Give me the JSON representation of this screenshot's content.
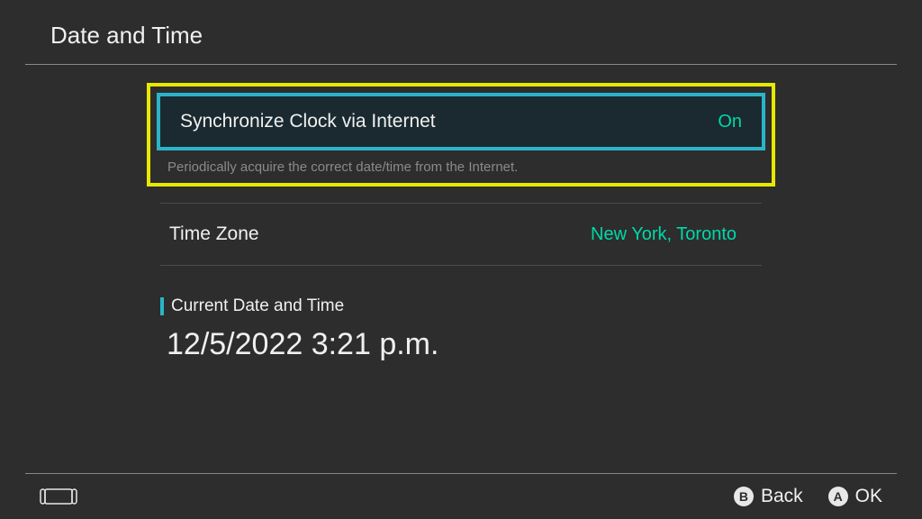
{
  "header": {
    "title": "Date and Time"
  },
  "settings": {
    "sync": {
      "label": "Synchronize Clock via Internet",
      "value": "On",
      "description": "Periodically acquire the correct date/time from the Internet."
    },
    "timezone": {
      "label": "Time Zone",
      "value": "New York, Toronto"
    },
    "current": {
      "section_label": "Current Date and Time",
      "datetime": "12/5/2022 3:21 p.m."
    }
  },
  "footer": {
    "back": {
      "button": "B",
      "label": "Back"
    },
    "ok": {
      "button": "A",
      "label": "OK"
    }
  }
}
